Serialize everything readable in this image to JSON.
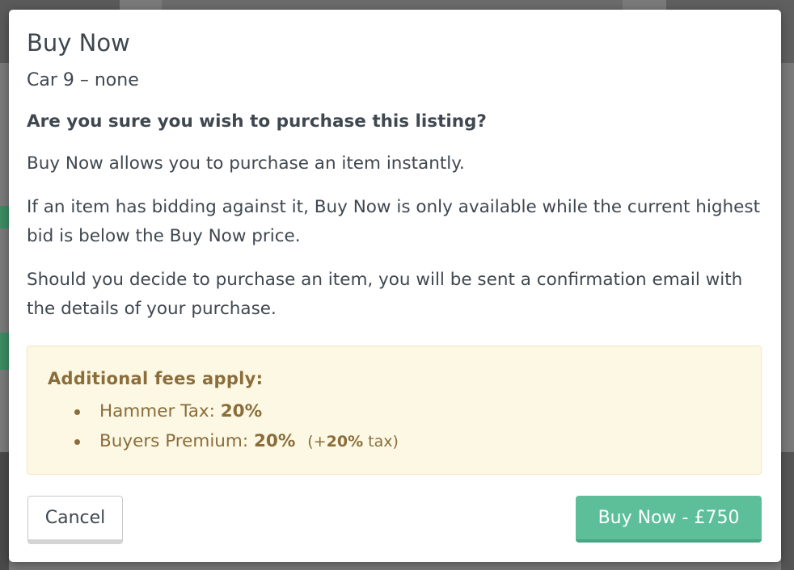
{
  "modal": {
    "title": "Buy Now",
    "subtitle": "Car 9 – none",
    "question": "Are you sure you wish to purchase this listing?",
    "paragraphs": [
      "Buy Now allows you to purchase an item instantly.",
      "If an item has bidding against it, Buy Now is only available while the current highest bid is below the Buy Now price.",
      "Should you decide to purchase an item, you will be sent a confirmation email with the details of your purchase."
    ],
    "fees": {
      "title": "Additional fees apply:",
      "items": [
        {
          "label": "Hammer Tax:",
          "value": "20%"
        },
        {
          "label": "Buyers Premium:",
          "value": "20%",
          "tax_prefix": "(+",
          "tax_value": "20%",
          "tax_suffix": " tax)"
        }
      ]
    },
    "buttons": {
      "cancel": "Cancel",
      "buy": "Buy Now - £750"
    }
  },
  "colors": {
    "accent": "#5dbf9a",
    "warning_bg": "#fcf8e3",
    "warning_text": "#8a6d3b",
    "text": "#3f4750"
  }
}
